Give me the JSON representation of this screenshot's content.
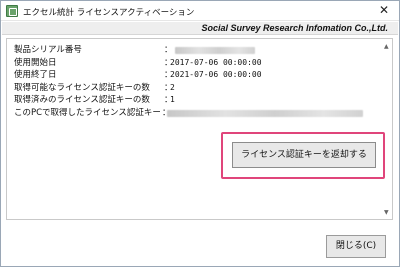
{
  "window": {
    "title": "エクセル統計 ライセンスアクティベーション",
    "close_glyph": "✕"
  },
  "company": {
    "name": "Social Survey Research Infomation Co.,Ltd."
  },
  "info": {
    "rows": [
      {
        "label": "製品シリアル番号",
        "colon": "：",
        "value": ""
      },
      {
        "label": "使用開始日",
        "colon": "：",
        "value": "2017-07-06 00:00:00"
      },
      {
        "label": "使用終了日",
        "colon": "：",
        "value": "2021-07-06 00:00:00"
      },
      {
        "label": "取得可能なライセンス認証キーの数",
        "colon": "：",
        "value": "2"
      },
      {
        "label": "取得済みのライセンス認証キーの数",
        "colon": "：",
        "value": "1"
      },
      {
        "label": "このPCで取得したライセンス認証キー",
        "colon": "：",
        "value": ""
      }
    ]
  },
  "actions": {
    "return_key_label": "ライセンス認証キーを返却する",
    "close_label": "閉じる(C)"
  },
  "scroll": {
    "up_glyph": "▲",
    "down_glyph": "▼"
  },
  "colors": {
    "highlight": "#e0457b",
    "app_icon": "#6aa36b"
  },
  "icons": {
    "app": "excel-statistics-app-icon",
    "close": "close-icon"
  }
}
